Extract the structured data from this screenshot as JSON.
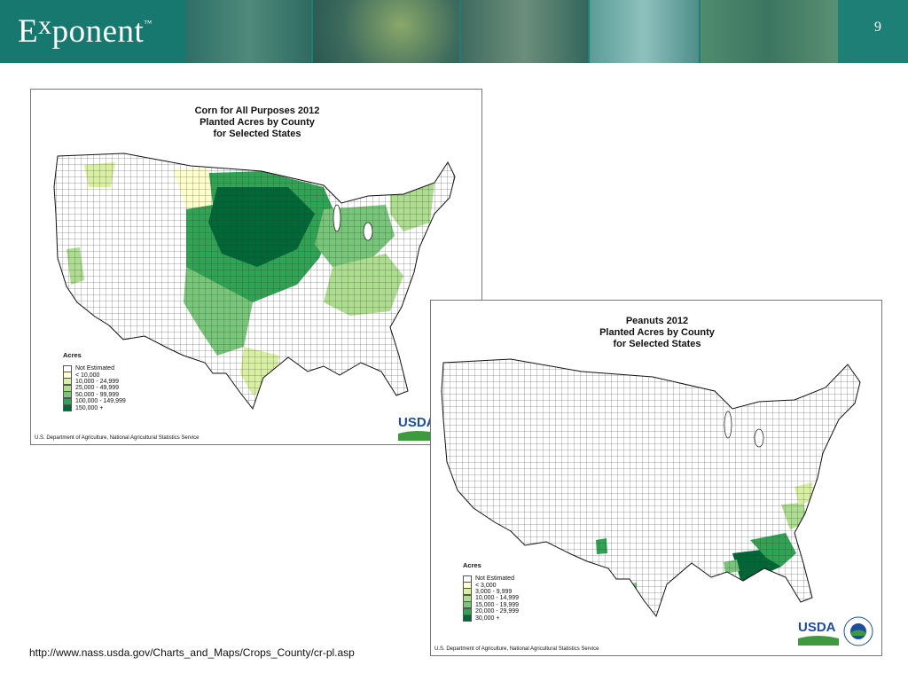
{
  "header": {
    "logo_text_e": "E",
    "logo_text_x": "x",
    "logo_text_rest": "ponent",
    "logo_tm": "™",
    "slide_number": "9",
    "colors": {
      "bar": "#1d7f76"
    }
  },
  "maps": {
    "corn": {
      "title_line1": "Corn for All Purposes 2012",
      "title_line2": "Planted Acres by County",
      "title_line3": "for Selected States",
      "legend_title": "Acres",
      "legend": [
        {
          "label": "Not Estimated",
          "color": "#ffffff"
        },
        {
          "label": "< 10,000",
          "color": "#ffffcc"
        },
        {
          "label": "10,000 -   24,999",
          "color": "#d9f0a3"
        },
        {
          "label": "25,000 -   49,999",
          "color": "#addd8e"
        },
        {
          "label": "50,000 -   99,999",
          "color": "#78c679"
        },
        {
          "label": "100,000 -  149,999",
          "color": "#31a354"
        },
        {
          "label": "150,000 +",
          "color": "#006837"
        }
      ],
      "source": "U.S. Department of Agriculture, National Agricultural Statistics Service"
    },
    "peanuts": {
      "title_line1": "Peanuts 2012",
      "title_line2": "Planted Acres by County",
      "title_line3": "for Selected States",
      "legend_title": "Acres",
      "legend": [
        {
          "label": "Not Estimated",
          "color": "#ffffff"
        },
        {
          "label": "< 3,000",
          "color": "#ffffcc"
        },
        {
          "label": "3,000 -   9,999",
          "color": "#d9f0a3"
        },
        {
          "label": "10,000 -  14,999",
          "color": "#addd8e"
        },
        {
          "label": "15,000 -  19,999",
          "color": "#78c679"
        },
        {
          "label": "20,000 -  29,999",
          "color": "#31a354"
        },
        {
          "label": "30,000 +",
          "color": "#006837"
        }
      ],
      "source": "U.S. Department of Agriculture, National Agricultural Statistics Service"
    }
  },
  "usda_logo": {
    "text": "USDA",
    "seal_text": "AGRICULTURE COUNTS",
    "colors": {
      "blue": "#1e4d9b",
      "green": "#3f9a3f"
    }
  },
  "url": "http://www.nass.usda.gov/Charts_and_Maps/Crops_County/cr-pl.asp"
}
